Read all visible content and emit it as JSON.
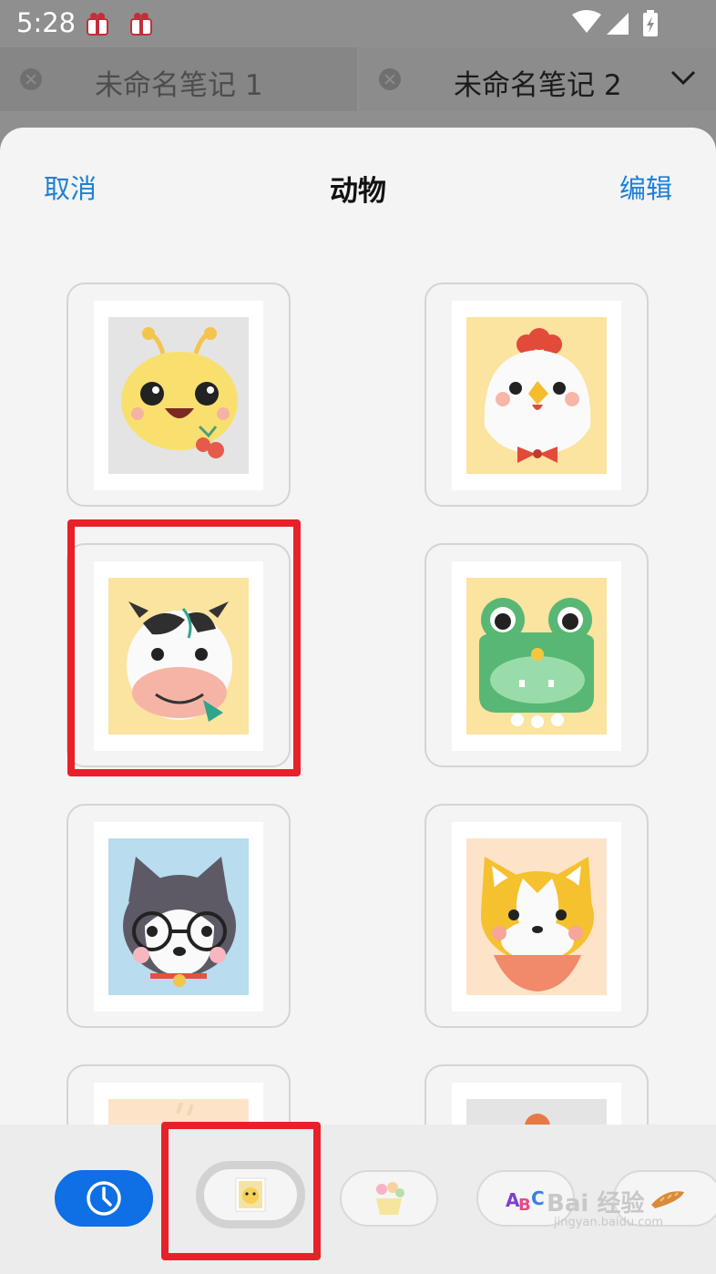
{
  "status_bar": {
    "time": "5:28"
  },
  "tabs": [
    {
      "title": "未命名笔记 1",
      "active": false
    },
    {
      "title": "未命名笔记 2",
      "active": true
    }
  ],
  "sheet": {
    "cancel_label": "取消",
    "title": "动物",
    "edit_label": "编辑"
  },
  "stickers": [
    {
      "name": "caterpillar",
      "bg": "#e4e4e4"
    },
    {
      "name": "chicken",
      "bg": "#fbe3a0"
    },
    {
      "name": "cow",
      "bg": "#fbe3a0",
      "selected": true
    },
    {
      "name": "frog",
      "bg": "#fbe3a0"
    },
    {
      "name": "husky",
      "bg": "#b9dcef"
    },
    {
      "name": "corgi",
      "bg": "#fde3c8"
    }
  ],
  "categories": [
    {
      "name": "recent",
      "icon": "clock-icon",
      "active": true
    },
    {
      "name": "animals",
      "icon": "chick-thumbnail-icon",
      "highlighted": true
    },
    {
      "name": "flowers",
      "icon": "flower-pot-icon"
    },
    {
      "name": "letters",
      "icon": "abc-icon"
    },
    {
      "name": "food",
      "icon": "bread-icon"
    }
  ],
  "watermark": {
    "text": "Bai 经验",
    "sub": "jingyan.baidu.com"
  },
  "colors": {
    "accent": "#1e80d6",
    "highlight": "#e8202a",
    "active_pill": "#0f6fe4"
  }
}
